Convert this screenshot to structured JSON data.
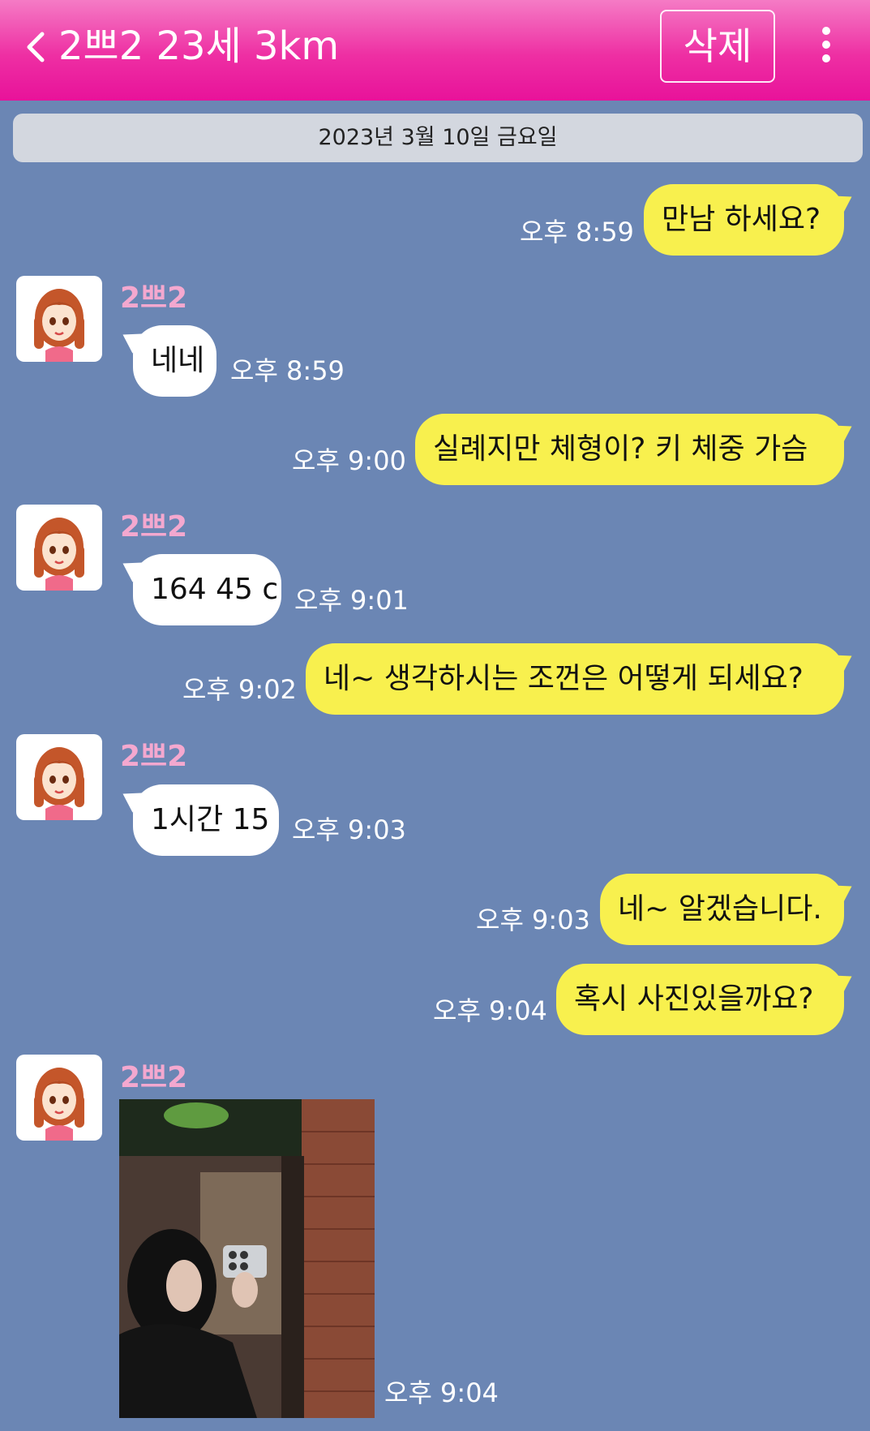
{
  "header": {
    "title": "2쁘2 23세 3km",
    "delete_label": "삭제"
  },
  "date_banner": "2023년 3월 10일 금요일",
  "messages": [
    {
      "from": "me",
      "text": "만남 하세요?",
      "time": "오후 8:59"
    },
    {
      "from": "them",
      "sender": "2쁘2",
      "text": "네네",
      "time": "오후 8:59"
    },
    {
      "from": "me",
      "text": "실례지만 체형이? 키 체중 가슴",
      "time": "오후 9:00"
    },
    {
      "from": "them",
      "sender": "2쁘2",
      "text": "164 45 c",
      "time": "오후 9:01"
    },
    {
      "from": "me",
      "text": "네~ 생각하시는 조껀은 어떻게 되세요?",
      "time": "오후 9:02"
    },
    {
      "from": "them",
      "sender": "2쁘2",
      "text": "1시간 15",
      "time": "오후 9:03"
    },
    {
      "from": "me",
      "text": "네~ 알겠습니다.",
      "time": "오후 9:03"
    },
    {
      "from": "me",
      "text": "혹시 사진있을까요?",
      "time": "오후 9:04"
    },
    {
      "from": "them",
      "sender": "2쁘2",
      "type": "photo",
      "time": "오후 9:04"
    }
  ],
  "icons": {
    "back": "chevron-left-icon",
    "more": "more-vertical-icon",
    "avatar": "cartoon-girl-avatar"
  },
  "colors": {
    "header": "#ee2fa3",
    "background": "#6b86b4",
    "my_bubble": "#f8f04e",
    "their_bubble": "#ffffff",
    "sender_name": "#f4a8cf"
  }
}
